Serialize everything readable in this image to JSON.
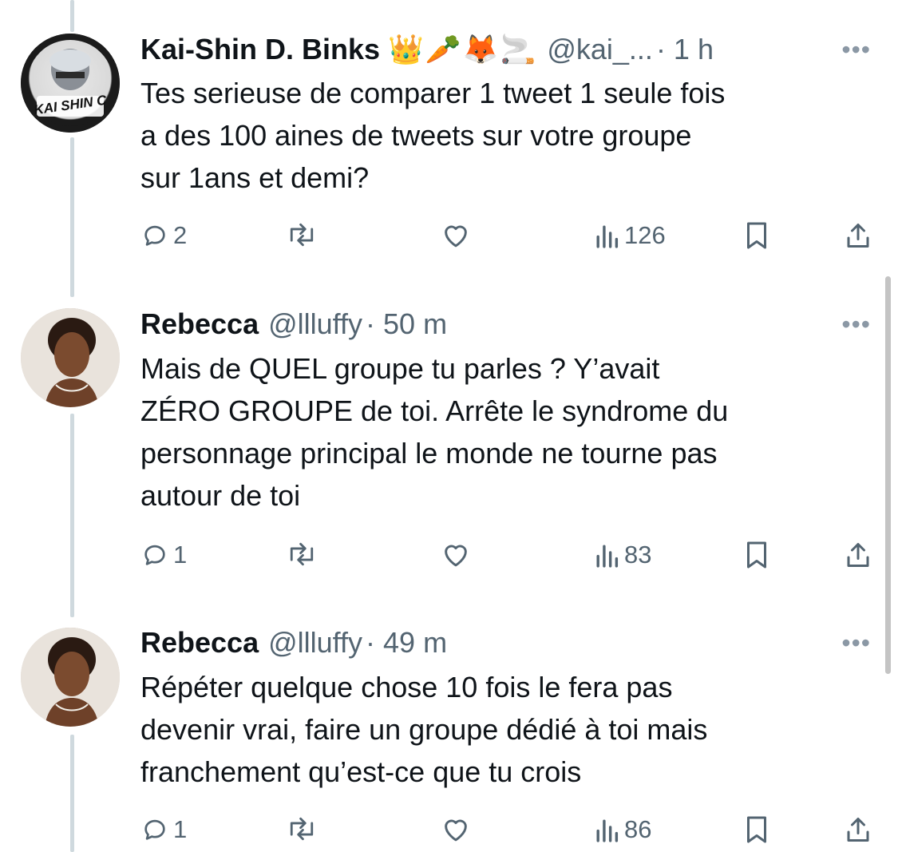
{
  "tweets": [
    {
      "name": "Kai-Shin D. Binks",
      "emojis": "👑🥕🦊🚬",
      "handle": "@kai_...",
      "time": "· 1 h",
      "text": "Tes serieuse de comparer 1 tweet 1 seule fois\na des 100 aines de tweets sur votre groupe\nsur 1ans et demi?",
      "replies": "2",
      "views": "126",
      "avatar_text": "KAI SHIN C"
    },
    {
      "name": "Rebecca",
      "emojis": "",
      "handle": "@llluffy",
      "time": "· 50 m",
      "text": "Mais de QUEL groupe tu parles ? Y’avait\nZÉRO GROUPE de toi. Arrête le syndrome du\npersonnage principal le monde ne tourne pas\nautour de toi",
      "replies": "1",
      "views": "83",
      "avatar_text": ""
    },
    {
      "name": "Rebecca",
      "emojis": "",
      "handle": "@llluffy",
      "time": "· 49 m",
      "text": "Répéter quelque chose 10 fois le fera pas\ndevenir vrai, faire un groupe dédié à toi mais\nfranchement qu’est-ce que tu crois",
      "replies": "1",
      "views": "86",
      "avatar_text": ""
    }
  ],
  "more_icon": "•••",
  "icons": {
    "reply": "reply-icon",
    "retweet": "retweet-icon",
    "like": "like-icon",
    "views": "views-icon",
    "bookmark": "bookmark-icon",
    "share": "share-icon"
  },
  "colors": {
    "text": "#0f1419",
    "secondary": "#536471",
    "thread_line": "#cfd9de"
  }
}
